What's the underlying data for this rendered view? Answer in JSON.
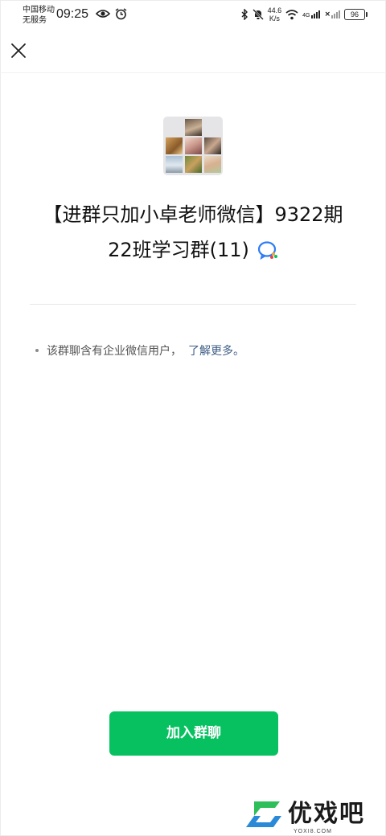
{
  "status_bar": {
    "carrier_line1": "中国移动",
    "carrier_line2": "无服务",
    "time": "09:25",
    "net_speed_value": "44.6",
    "net_speed_unit": "K/s",
    "network_type": "4G",
    "battery": "96"
  },
  "group": {
    "name_line1": "【进群只加小卓老师微信】9322期",
    "name_line2": "22班学习群(11)"
  },
  "notice": {
    "text": "该群聊含有企业微信用户，",
    "link": "了解更多。"
  },
  "join_button": {
    "label": "加入群聊"
  },
  "watermark": {
    "text": "优戏吧",
    "sub": "YOXI8.COM"
  },
  "colors": {
    "primary_green": "#07c160",
    "link_blue": "#3d5c85",
    "wecom_icon_blue": "#2f7cf6"
  }
}
